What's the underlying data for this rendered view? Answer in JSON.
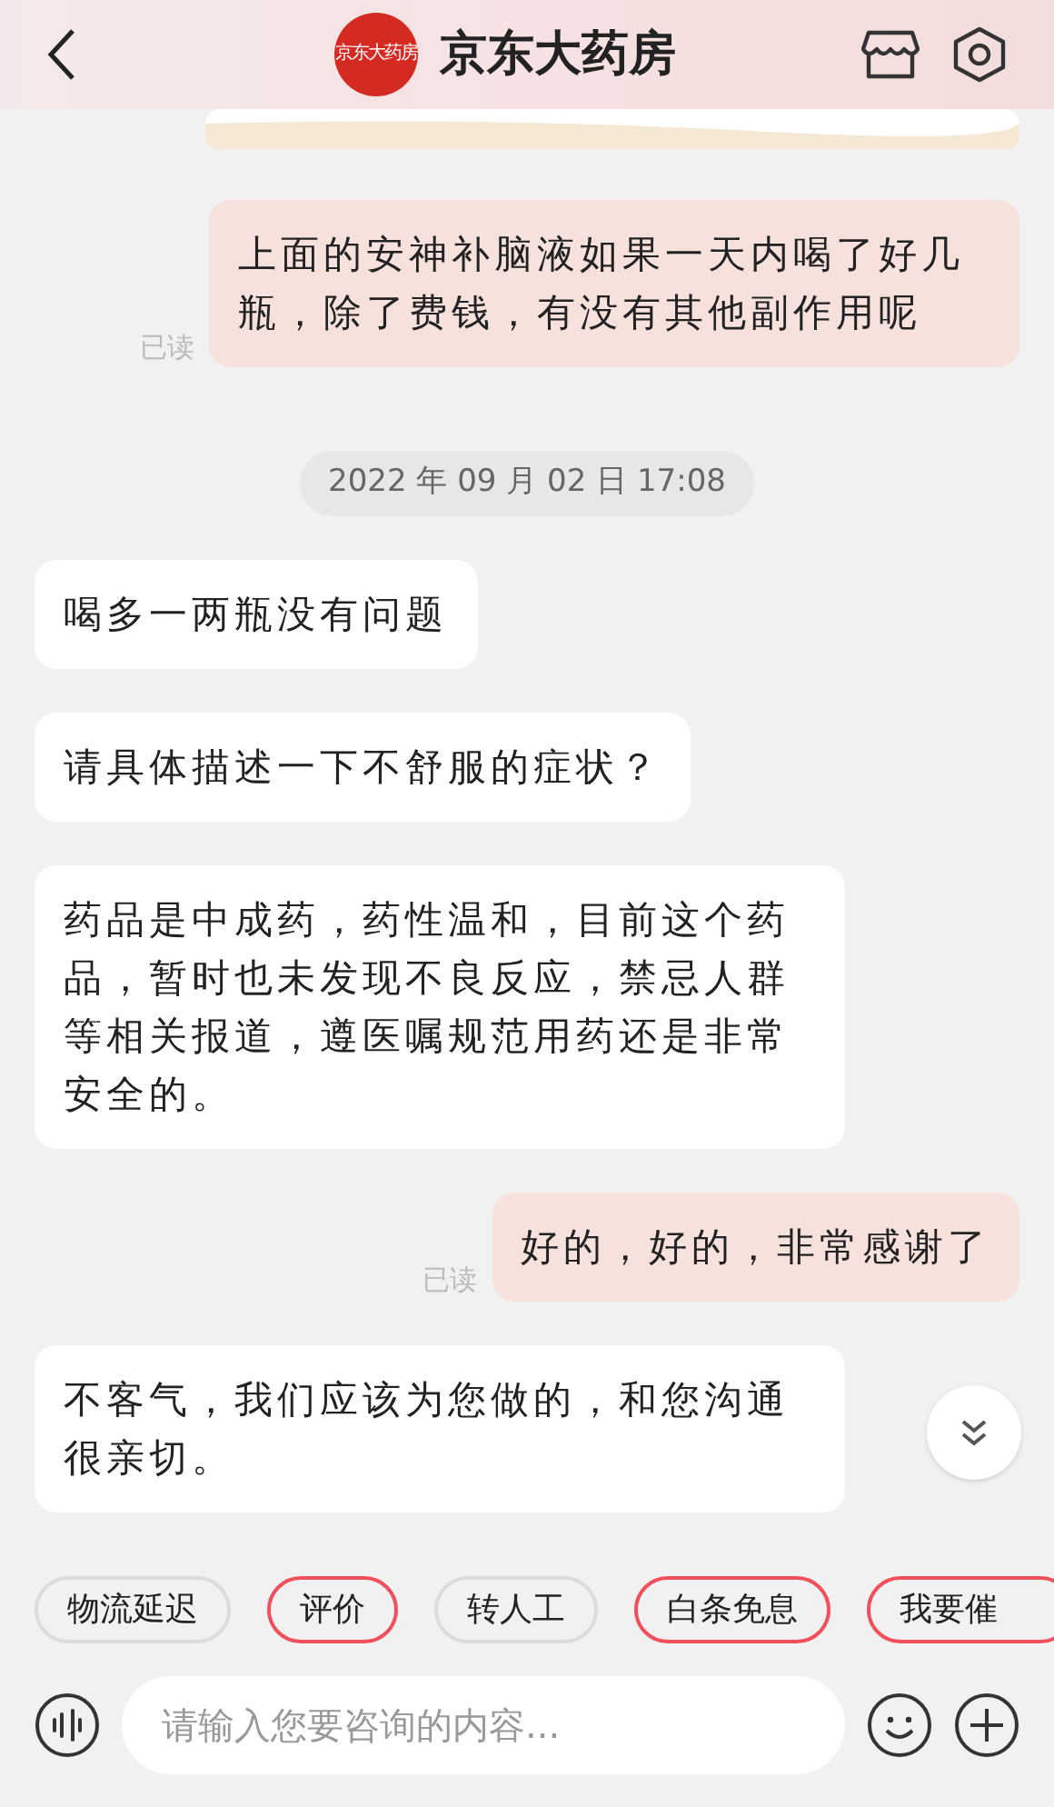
{
  "header": {
    "logo_text": "京东大药房",
    "title": "京东大药房"
  },
  "messages": [
    {
      "kind": "sent",
      "text": "上面的安神补脑液如果一天内喝了好几瓶，除了费钱，有没有其他副作用呢",
      "status": "已读"
    },
    {
      "kind": "time",
      "text": "2022 年 09 月 02 日 17:08"
    },
    {
      "kind": "received",
      "text": "喝多一两瓶没有问题"
    },
    {
      "kind": "received",
      "text": "请具体描述一下不舒服的症状？"
    },
    {
      "kind": "received",
      "text": "药品是中成药，药性温和，目前这个药品，暂时也未发现不良反应，禁忌人群等相关报道，遵医嘱规范用药还是非常安全的。"
    },
    {
      "kind": "sent",
      "text": "好的，好的，非常感谢了",
      "status": "已读"
    },
    {
      "kind": "received",
      "text": "不客气，我们应该为您做的，和您沟通很亲切。"
    }
  ],
  "quick_replies": [
    {
      "label": "物流延迟",
      "highlighted": false
    },
    {
      "label": "评价",
      "highlighted": true
    },
    {
      "label": "转人工",
      "highlighted": false
    },
    {
      "label": "白条免息",
      "highlighted": true
    },
    {
      "label": "我要催",
      "highlighted": true
    }
  ],
  "input": {
    "placeholder": "请输入您要咨询的内容..."
  }
}
